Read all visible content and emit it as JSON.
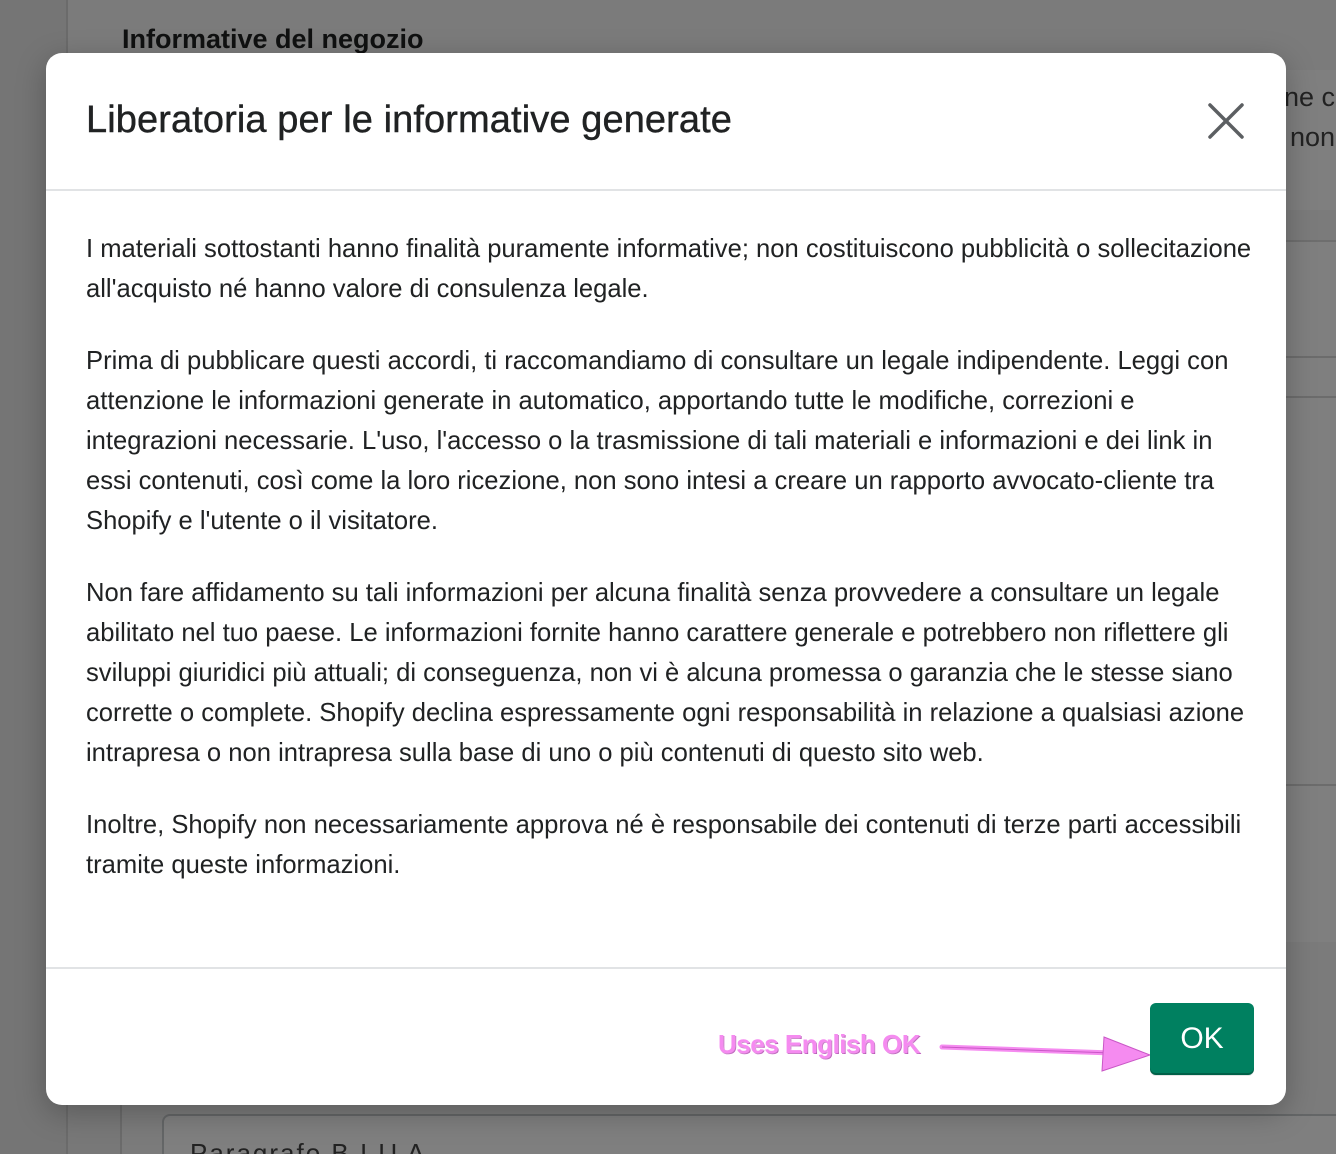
{
  "background": {
    "section_title": "Informative del negozio",
    "card_line1": "ne c",
    "card_line2": "non",
    "editor_toolbar": "Paragrafo   B  I  U  A"
  },
  "modal": {
    "title": "Liberatoria per le informative generate",
    "close_icon": "close-icon",
    "paragraphs": [
      "I materiali sottostanti hanno finalità puramente informative; non costituiscono pubblicità o sollecitazione all'acquisto né hanno valore di consulenza legale.",
      "Prima di pubblicare questi accordi, ti raccomandiamo di consultare un legale indipendente. Leggi con attenzione le informazioni generate in automatico, apportando tutte le modifiche, correzioni e integrazioni necessarie. L'uso, l'accesso o la trasmissione di tali materiali e informazioni e dei link in essi contenuti, così come la loro ricezione, non sono intesi a creare un rapporto avvocato-cliente tra Shopify e l'utente o il visitatore.",
      "Non fare affidamento su tali informazioni per alcuna finalità senza provvedere a consultare un legale abilitato nel tuo paese. Le informazioni fornite hanno carattere generale e potrebbero non riflettere gli sviluppi giuridici più attuali; di conseguenza, non vi è alcuna promessa o garanzia che le stesse siano corrette o complete. Shopify declina espressamente ogni responsabilità in relazione a qualsiasi azione intrapresa o non intrapresa sulla base di uno o più contenuti di questo sito web.",
      "Inoltre, Shopify non necessariamente approva né è responsabile dei contenuti di terze parti accessibili tramite queste informazioni."
    ],
    "ok_label": "OK"
  },
  "annotation": {
    "text": "Uses English OK",
    "color": "#f58bf0"
  },
  "colors": {
    "primary_button": "#008060",
    "overlay": "rgba(0,0,0,0.5)"
  }
}
